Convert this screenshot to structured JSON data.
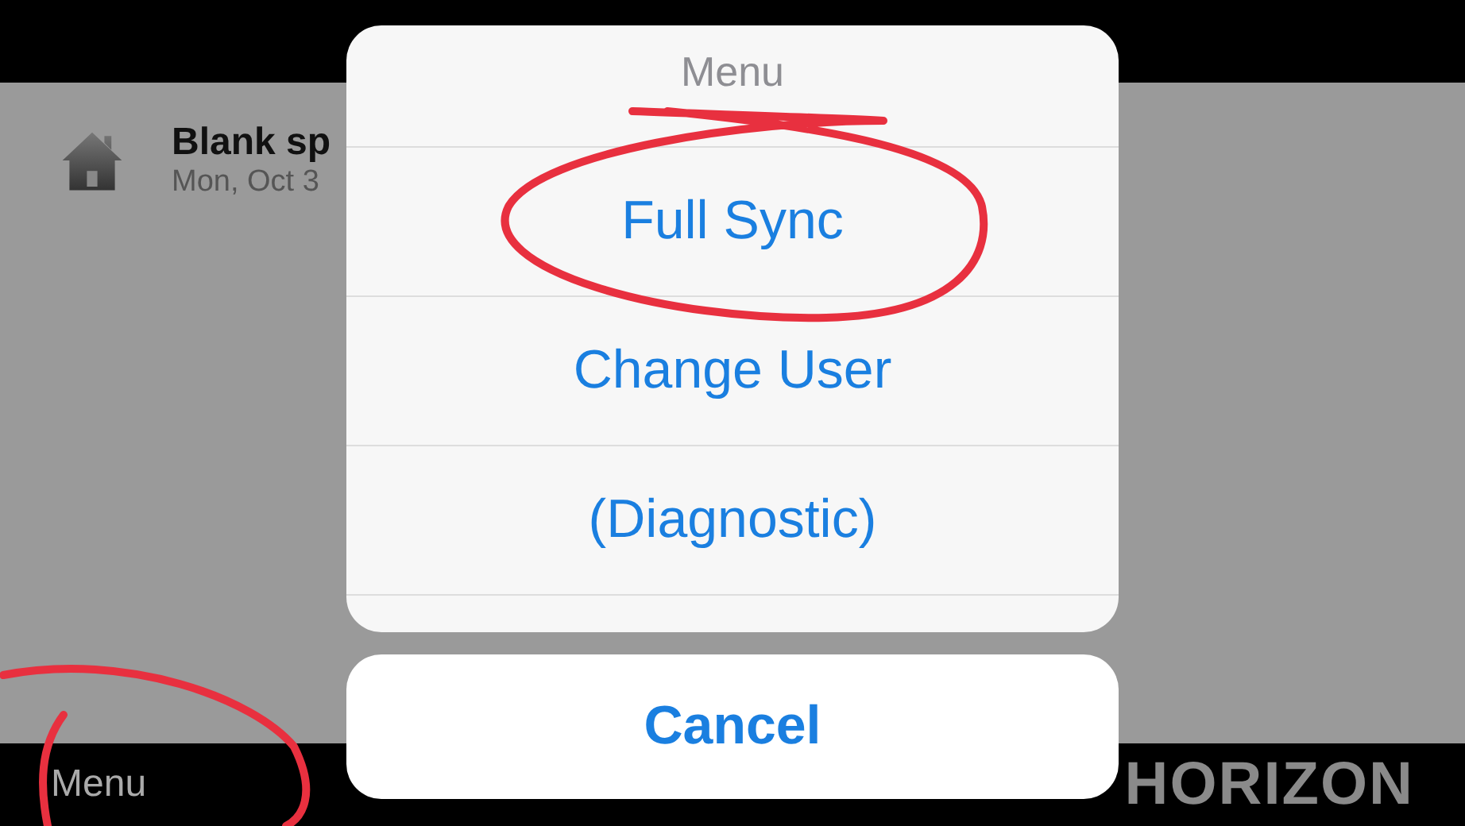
{
  "list": [
    {
      "title": "Blank sp",
      "subtitle": "Mon, Oct 3"
    }
  ],
  "bottom_bar": {
    "menu_label": "Menu",
    "logo": "HORIZON"
  },
  "action_sheet": {
    "title": "Menu",
    "actions": [
      "Full Sync",
      "Change User",
      "(Diagnostic)"
    ],
    "cancel": "Cancel"
  }
}
